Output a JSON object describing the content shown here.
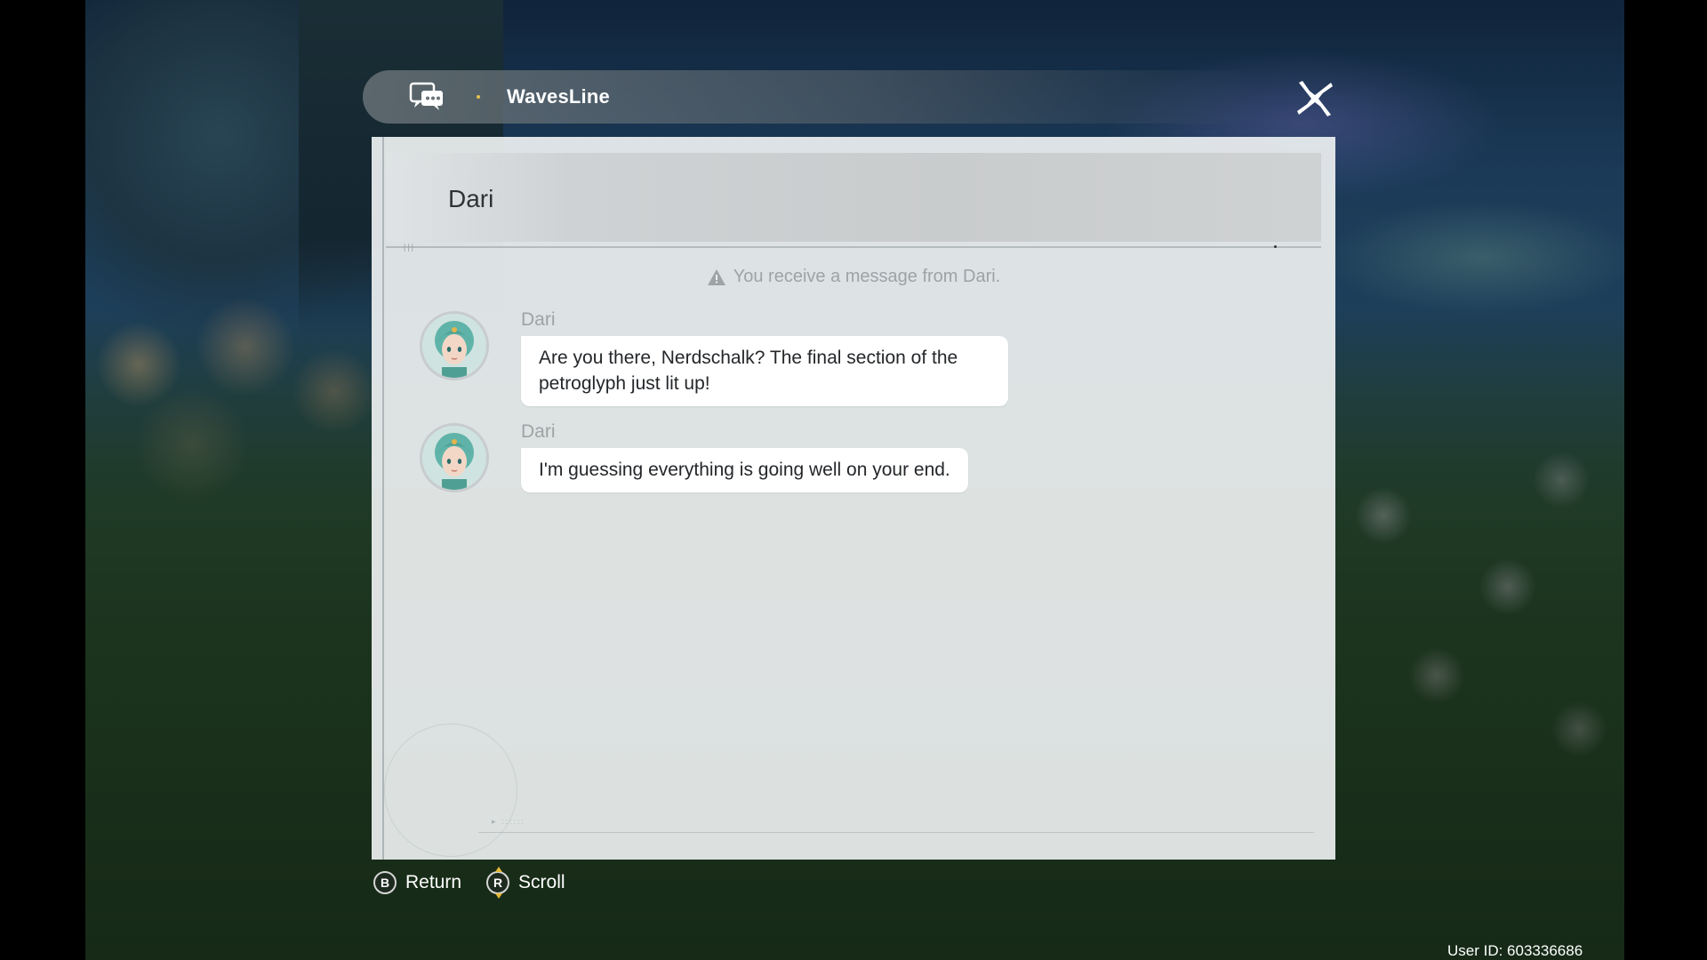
{
  "app": {
    "title": "WavesLine",
    "icon": "chat-bubbles-icon",
    "close_icon": "close-x-icon",
    "accent_dot_color": "#e8c24a"
  },
  "conversation": {
    "contact_name": "Dari",
    "system_notice": "You receive a message from Dari.",
    "notice_icon": "warning-triangle-icon",
    "messages": [
      {
        "sender": "Dari",
        "text": "Are you there, Nerdschalk? The final section of the petroglyph just lit up!"
      },
      {
        "sender": "Dari",
        "text": "I'm guessing everything is going well on your end."
      }
    ]
  },
  "footer": {
    "return_button": {
      "glyph": "B",
      "label": "Return"
    },
    "scroll_button": {
      "glyph": "R",
      "label": "Scroll"
    }
  },
  "user_id": "User ID: 603336686"
}
